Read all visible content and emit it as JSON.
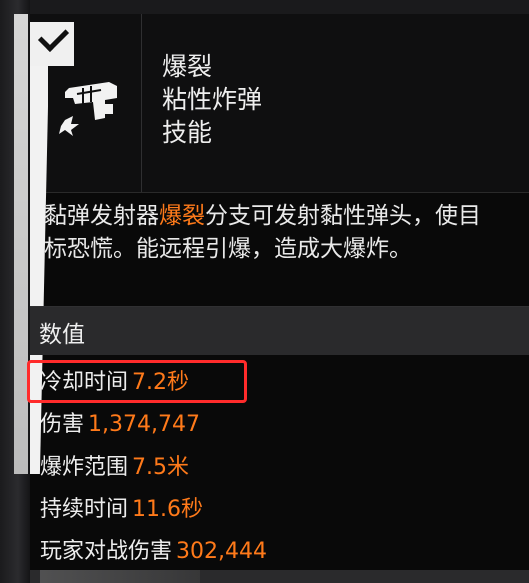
{
  "item": {
    "titles": [
      "爆裂",
      "粘性炸弹",
      "技能"
    ],
    "icon": "sticky-bomb-launcher-icon",
    "checkmark_icon": "checkmark-icon"
  },
  "description": {
    "before": "黏弹发射器",
    "highlight": "爆裂",
    "after": "分支可发射黏性弹头，使目标恐慌。能远程引爆，造成大爆炸。"
  },
  "stats_section": {
    "title": "数值",
    "rows": [
      {
        "label": "冷却时间",
        "value": "7.2秒"
      },
      {
        "label": "伤害",
        "value": "1,374,747"
      },
      {
        "label": "爆炸范围",
        "value": "7.5米"
      },
      {
        "label": "持续时间",
        "value": "11.6秒"
      },
      {
        "label": "玩家对战伤害",
        "value": "302,444"
      }
    ]
  },
  "colors": {
    "accent_orange": "#ff7a1a",
    "highlight_box": "#ff2b2b",
    "text": "#eeeeee",
    "background": "#0b0b0c"
  }
}
